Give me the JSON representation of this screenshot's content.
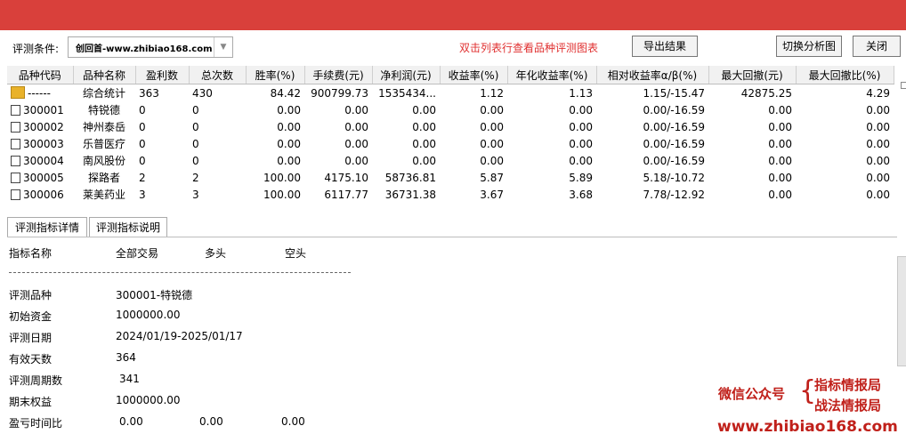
{
  "toolbar": {
    "label": "评测条件:",
    "combo_value": "创回首-www.zhibiao168.com",
    "hint": "双击列表行查看品种评测图表",
    "export_label": "导出结果",
    "switch_label": "切换分析图",
    "close_label": "关闭"
  },
  "table": {
    "headers": [
      "品种代码",
      "品种名称",
      "盈利数",
      "总次数",
      "胜率(%)",
      "手续费(元)",
      "净利润(元)",
      "收益率(%)",
      "年化收益率(%)",
      "相对收益率α/β(%)",
      "最大回撤(元)",
      "最大回撤比(%)"
    ],
    "rows": [
      {
        "code": "------",
        "name": "综合统计",
        "win": "363",
        "total": "430",
        "rate": "84.42",
        "fee": "900799.73",
        "net": "1535434...",
        "ret": "1.12",
        "annual": "1.13",
        "rel": "1.15/-15.47",
        "dd": "42875.25",
        "ddr": "4.29"
      },
      {
        "code": "300001",
        "name": "特锐德",
        "win": "0",
        "total": "0",
        "rate": "0.00",
        "fee": "0.00",
        "net": "0.00",
        "ret": "0.00",
        "annual": "0.00",
        "rel": "0.00/-16.59",
        "dd": "0.00",
        "ddr": "0.00"
      },
      {
        "code": "300002",
        "name": "神州泰岳",
        "win": "0",
        "total": "0",
        "rate": "0.00",
        "fee": "0.00",
        "net": "0.00",
        "ret": "0.00",
        "annual": "0.00",
        "rel": "0.00/-16.59",
        "dd": "0.00",
        "ddr": "0.00"
      },
      {
        "code": "300003",
        "name": "乐普医疗",
        "win": "0",
        "total": "0",
        "rate": "0.00",
        "fee": "0.00",
        "net": "0.00",
        "ret": "0.00",
        "annual": "0.00",
        "rel": "0.00/-16.59",
        "dd": "0.00",
        "ddr": "0.00"
      },
      {
        "code": "300004",
        "name": "南风股份",
        "win": "0",
        "total": "0",
        "rate": "0.00",
        "fee": "0.00",
        "net": "0.00",
        "ret": "0.00",
        "annual": "0.00",
        "rel": "0.00/-16.59",
        "dd": "0.00",
        "ddr": "0.00"
      },
      {
        "code": "300005",
        "name": "探路者",
        "win": "2",
        "total": "2",
        "rate": "100.00",
        "fee": "4175.10",
        "net": "58736.81",
        "ret": "5.87",
        "annual": "5.89",
        "rel": "5.18/-10.72",
        "dd": "0.00",
        "ddr": "0.00"
      },
      {
        "code": "300006",
        "name": "莱美药业",
        "win": "3",
        "total": "3",
        "rate": "100.00",
        "fee": "6117.77",
        "net": "36731.38",
        "ret": "3.67",
        "annual": "3.68",
        "rel": "7.78/-12.92",
        "dd": "0.00",
        "ddr": "0.00"
      }
    ]
  },
  "tabs": [
    "评测指标详情",
    "评测指标说明"
  ],
  "detail": {
    "header": {
      "name": "指标名称",
      "all": "全部交易",
      "long": "多头",
      "short": "空头"
    },
    "lines": [
      {
        "label": "评测品种",
        "value": "300001-特锐德"
      },
      {
        "label": "初始资金",
        "value": "1000000.00"
      },
      {
        "label": "评测日期",
        "value": "2024/01/19-2025/01/17"
      },
      {
        "label": "有效天数",
        "value": "364"
      },
      {
        "label": "评测周期数",
        "value": "341"
      },
      {
        "label": "期末权益",
        "value": "1000000.00"
      }
    ],
    "last": {
      "label": "盈亏时间比",
      "all": "0.00",
      "long": "0.00",
      "short": "0.00"
    }
  },
  "watermark": {
    "wechat": "微信公众号",
    "brace": "{",
    "name1": "指标情报局",
    "name2": "战法情报局",
    "url": "www.zhibiao168.com"
  }
}
